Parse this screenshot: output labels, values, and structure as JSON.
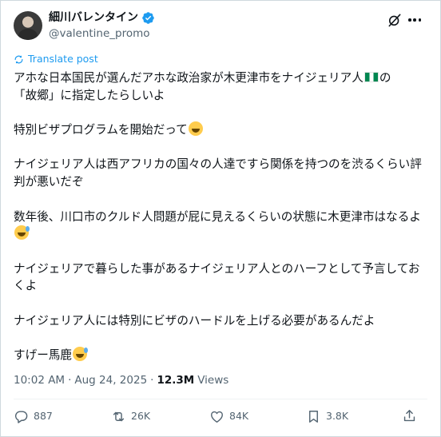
{
  "author": {
    "name": "細川バレンタイン",
    "handle": "@valentine_promo",
    "verified": true
  },
  "translate_label": "Translate post",
  "post": {
    "p1a": "アホな日本国民が選んだアホな政治家が木更津市をナイジェリア人",
    "p1b": "の",
    "p1c": "「故郷」に指定したらしいよ",
    "p2": "特別ビザプログラムを開始だって",
    "p3": "ナイジェリア人は西アフリカの国々の人達ですら関係を持つのを渋るくらい評判が悪いだぞ",
    "p4": "数年後、川口市のクルド人問題が屁に見えるくらいの状態に木更津市はなるよ",
    "p5": "ナイジェリアで暮らした事があるナイジェリア人とのハーフとして予言しておくよ",
    "p6": "ナイジェリア人には特別にビザのハードルを上げる必要があるんだよ",
    "p7": "すげー馬鹿"
  },
  "meta": {
    "time": "10:02 AM",
    "sep1": "·",
    "date": "Aug 24, 2025",
    "sep2": "·",
    "views_count": "12.3M",
    "views_label": "Views"
  },
  "actions": {
    "replies": "887",
    "reposts": "26K",
    "likes": "84K",
    "bookmarks": "3.8K"
  },
  "colors": {
    "accent": "#1d9bf0",
    "secondary_text": "#536471",
    "primary_text": "#0f1419"
  }
}
